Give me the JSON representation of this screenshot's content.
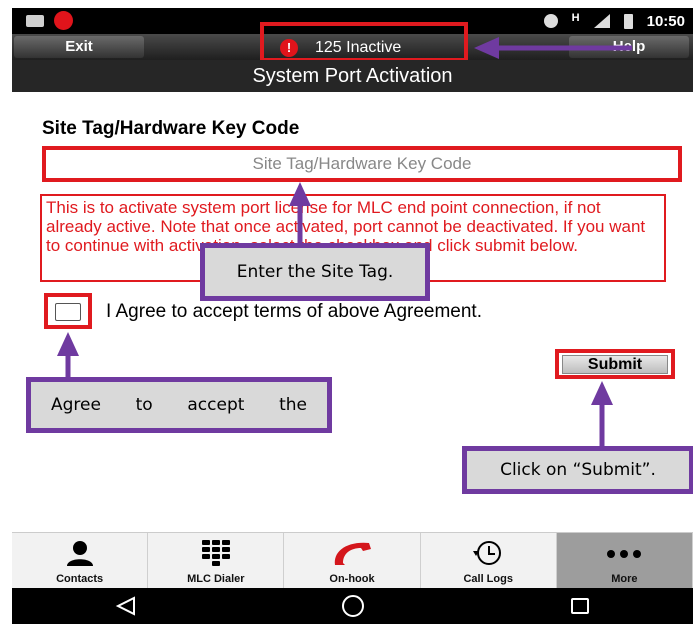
{
  "status_bar": {
    "time": "10:50",
    "network": "H"
  },
  "header": {
    "exit_label": "Exit",
    "status_badge": "125 Inactive",
    "help_label": "Help",
    "title": "System Port Activation"
  },
  "form": {
    "label": "Site Tag/Hardware Key Code",
    "placeholder": "Site Tag/Hardware Key Code",
    "notice": "This is to activate system port license for MLC end point connection, if not already active. Note that once activated, port cannot be deactivated. If you want to continue with activation, select the checkbox and click submit below.",
    "agree_label": "I Agree to accept terms of above Agreement.",
    "submit_label": "Submit"
  },
  "callouts": {
    "site_tag": "Enter the Site Tag.",
    "agree_words": [
      "Agree",
      "to",
      "accept",
      "the"
    ],
    "submit": "Click on “Submit”."
  },
  "bottom_nav": [
    {
      "label": "Contacts",
      "icon": "contacts-icon"
    },
    {
      "label": "MLC Dialer",
      "icon": "dialpad-icon"
    },
    {
      "label": "On-hook",
      "icon": "phone-hook-icon"
    },
    {
      "label": "Call Logs",
      "icon": "call-logs-icon"
    },
    {
      "label": "More",
      "icon": "more-icon"
    }
  ],
  "colors": {
    "highlight_red": "#e01a1f",
    "callout_purple": "#6f3aa0",
    "alert_red": "#e0141b"
  }
}
